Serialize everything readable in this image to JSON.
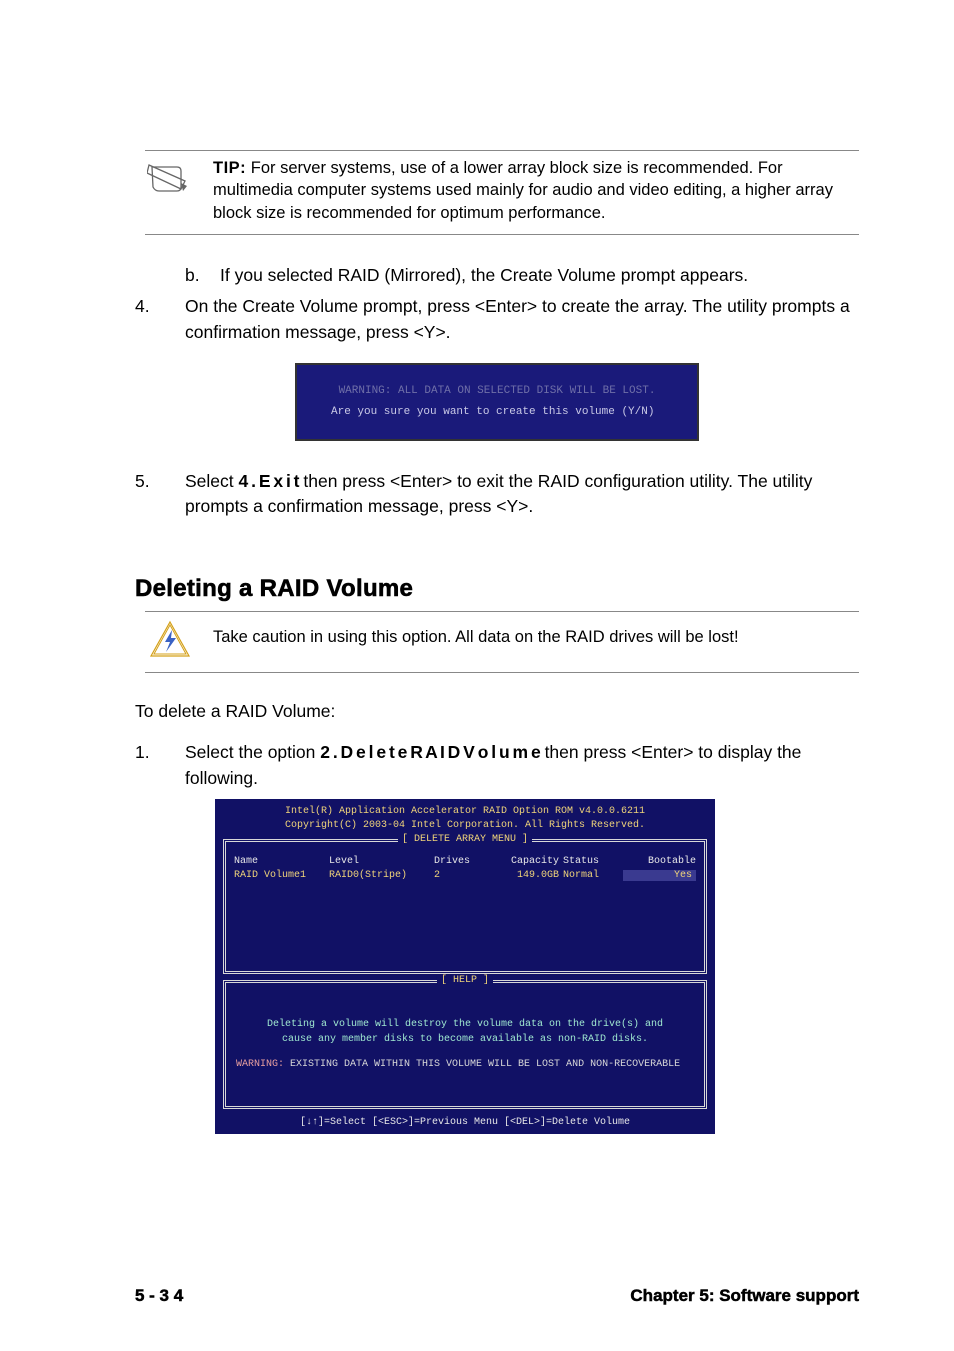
{
  "tip": {
    "label": "TIP:",
    "text": "For server systems, use of a lower array block size is recommended. For multimedia computer systems used mainly for audio and video editing, a higher array block size is recommended for optimum performance."
  },
  "step_b": {
    "marker": "b.",
    "text": "If you selected RAID (Mirrored), the Create Volume prompt appears."
  },
  "step4": {
    "marker": "4.",
    "text": "On the Create Volume prompt, press <Enter> to create the array. The utility prompts a confirmation message, press <Y>."
  },
  "dialog": {
    "warning": "WARNING:  ALL DATA ON SELECTED DISK WILL BE LOST.",
    "prompt": "Are you sure you want to create this volume (Y/N)"
  },
  "step5": {
    "marker": "5.",
    "pre": "Select ",
    "bold": "4 .  E x i t",
    "post": " then press <Enter> to exit the RAID configuration utility. The utility prompts a confirmation message, press <Y>."
  },
  "section_heading": "Deleting a RAID Volume",
  "caution": "Take caution in using this option. All data on the RAID drives will be lost!",
  "intro": "To delete a RAID Volume:",
  "step1": {
    "marker": "1.",
    "pre": "Select the option ",
    "bold": "2 .  D e l e t e  R A I D  V o l u m e",
    "post": " then press <Enter> to display the following."
  },
  "bios": {
    "header1": "Intel(R) Application Accelerator RAID Option ROM v4.0.0.6211",
    "header2": "Copyright(C) 2003-04 Intel Corporation. All Rights Reserved.",
    "panel1_title": "[ DELETE ARRAY MENU ]",
    "columns": {
      "name": "Name",
      "level": "Level",
      "drives": "Drives",
      "capacity": "Capacity",
      "status": "Status",
      "bootable": "Bootable"
    },
    "row": {
      "name": "RAID Volume1",
      "level": "RAID0(Stripe)",
      "drives": "2",
      "capacity": "149.0GB",
      "status": "Normal",
      "bootable": "Yes"
    },
    "panel2_title": "[ HELP ]",
    "help_line1": "Deleting a volume will destroy the volume data on the drive(s) and",
    "help_line2": "cause any member disks to become available as non-RAID disks.",
    "warn_label": "WARNING:",
    "warn_text": " EXISTING DATA WITHIN THIS VOLUME WILL BE LOST AND NON-RECOVERABLE",
    "footer": "[↓↑]=Select    [<ESC>]=Previous Menu   [<DEL>]=Delete Volume"
  },
  "footer": {
    "page": "5 - 3 4",
    "chapter": "Chapter 5: Software support"
  }
}
